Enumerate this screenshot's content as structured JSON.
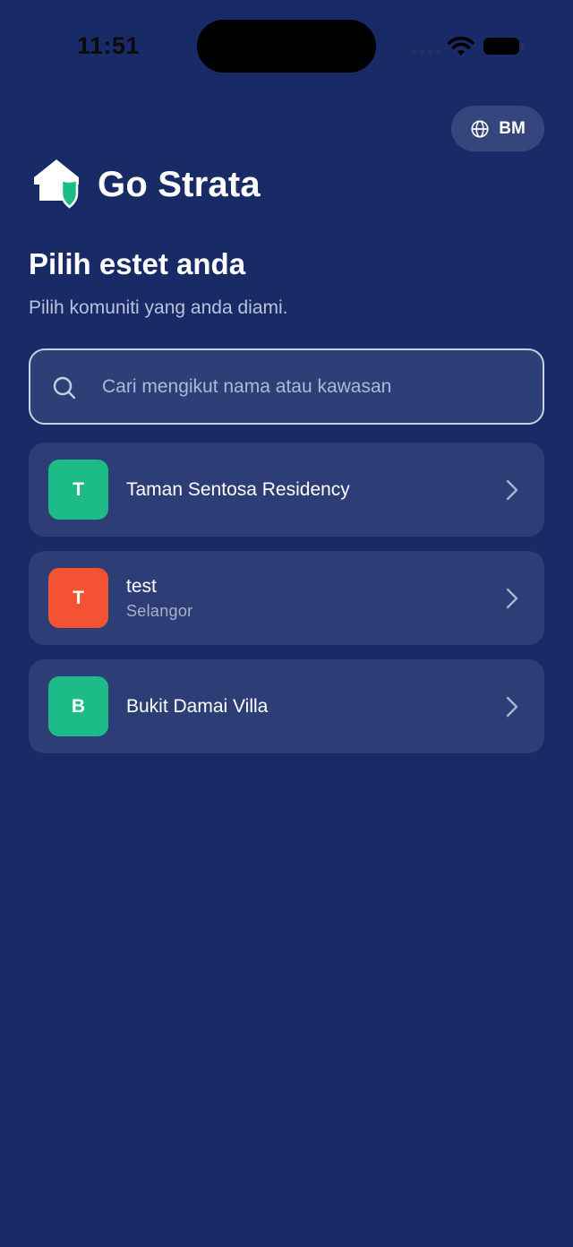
{
  "status_bar": {
    "time": "11:51",
    "icons": [
      "signal-icon",
      "wifi-icon",
      "battery-icon"
    ]
  },
  "language": {
    "icon": "globe-icon",
    "label": "BM"
  },
  "brand": {
    "logo": "house-shield-logo",
    "name": "Go Strata"
  },
  "header": {
    "title": "Pilih estet anda",
    "subtitle": "Pilih komuniti yang anda diami."
  },
  "search": {
    "icon": "search-icon",
    "placeholder": "Cari mengikut nama atau kawasan",
    "value": ""
  },
  "colors": {
    "background": "#192b66",
    "card": "#2c3e75",
    "green": "#1dbb87",
    "orange": "#f45333",
    "pill": "#34467c"
  },
  "estates": [
    {
      "initial": "T",
      "name": "Taman Sentosa Residency",
      "area": "",
      "color": "#1dbb87"
    },
    {
      "initial": "T",
      "name": "test",
      "area": "Selangor",
      "color": "#f45333"
    },
    {
      "initial": "B",
      "name": "Bukit Damai Villa",
      "area": "",
      "color": "#1dbb87"
    }
  ]
}
